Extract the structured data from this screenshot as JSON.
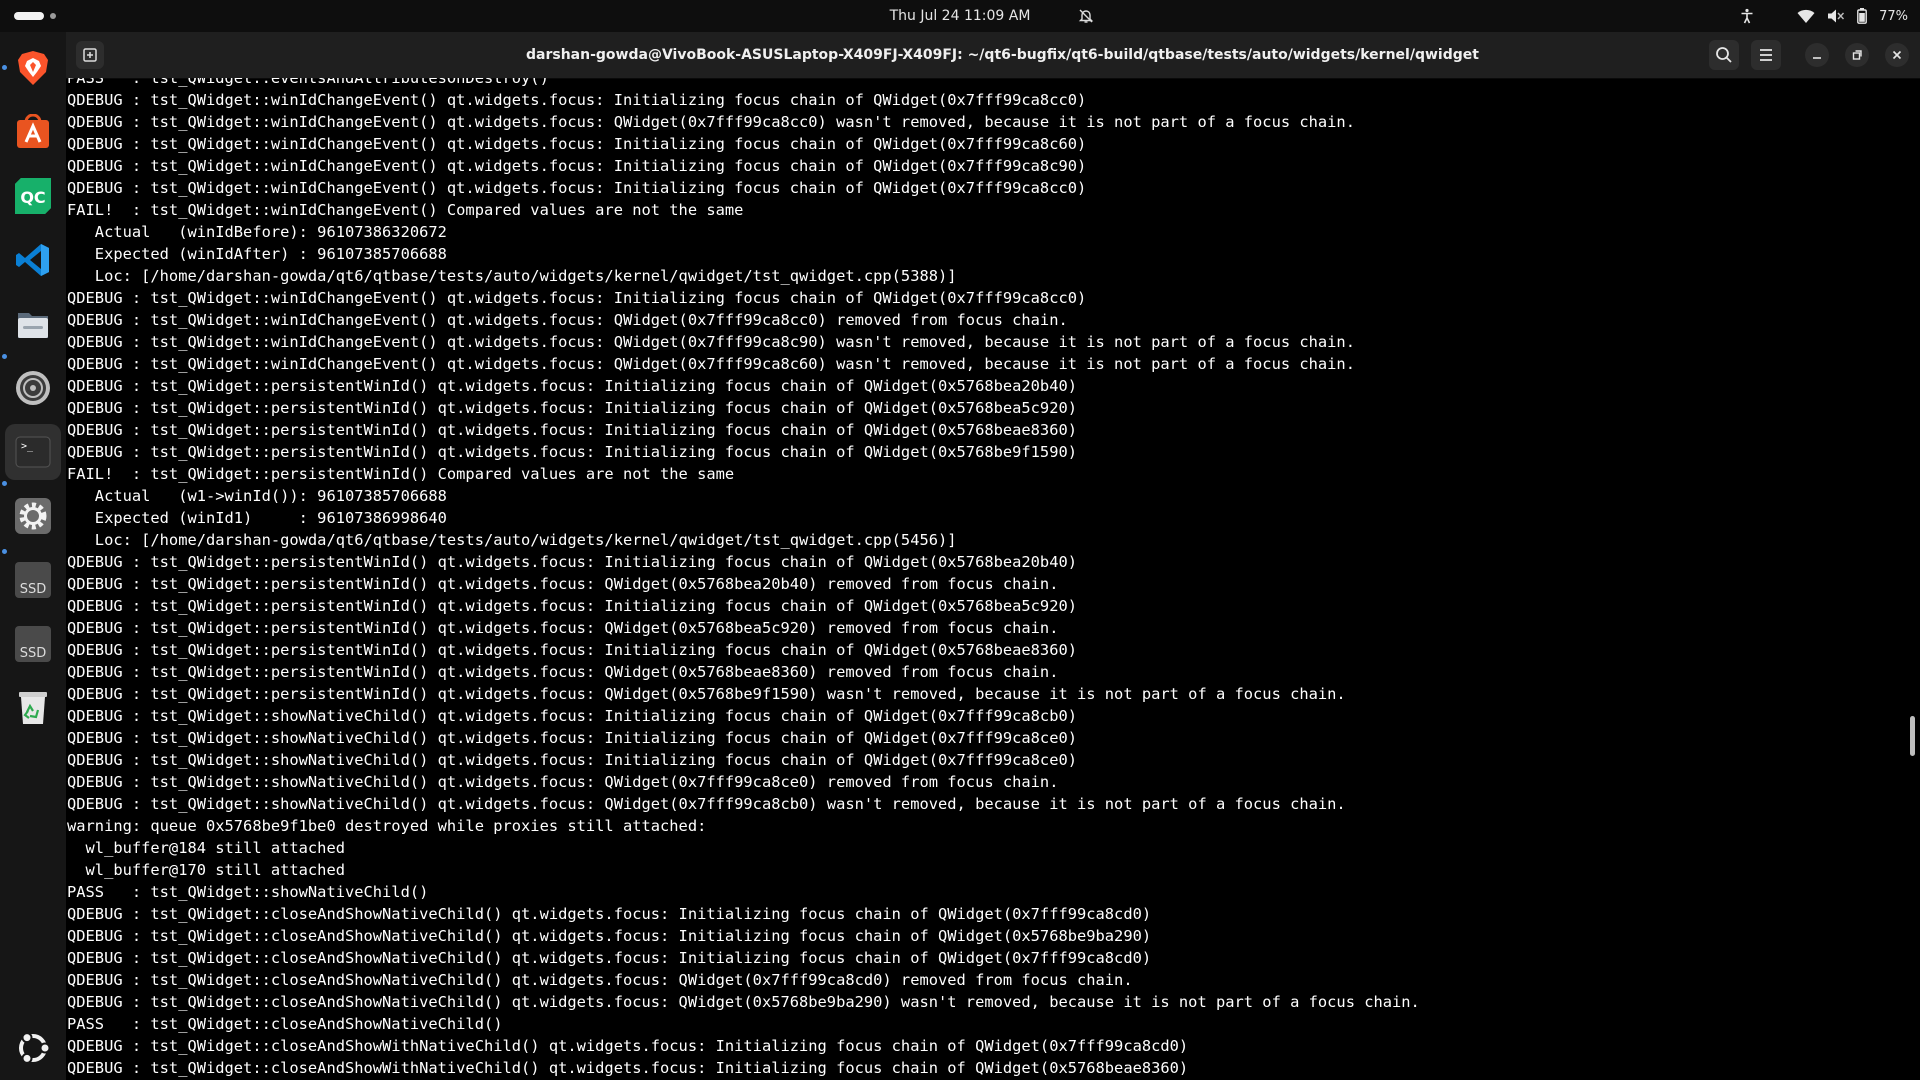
{
  "topbar": {
    "clock": "Thu Jul 24  11:09 AM",
    "battery": "77%",
    "icons": [
      "accessibility-icon",
      "wifi-icon",
      "volume-muted-icon",
      "battery-icon",
      "do-not-disturb-icon"
    ]
  },
  "dock": {
    "items": [
      "brave-browser",
      "app-center",
      "qt-creator",
      "visual-studio-code",
      "files",
      "disk-utility",
      "terminal",
      "settings",
      "ssd-drive-1",
      "ssd-drive-2",
      "trash",
      "show-apps"
    ],
    "ssd_label": "SSD"
  },
  "window": {
    "title": "darshan-gowda@VivoBook-ASUSLaptop-X409FJ-X409FJ: ~/qt6-bugfix/qt6-build/qtbase/tests/auto/widgets/kernel/qwidget"
  },
  "terminal": {
    "lines": [
      "PASS   : tst_QWidget::eventsAndAttributesOnDestroy()",
      "QDEBUG : tst_QWidget::winIdChangeEvent() qt.widgets.focus: Initializing focus chain of QWidget(0x7fff99ca8cc0)",
      "QDEBUG : tst_QWidget::winIdChangeEvent() qt.widgets.focus: QWidget(0x7fff99ca8cc0) wasn't removed, because it is not part of a focus chain.",
      "QDEBUG : tst_QWidget::winIdChangeEvent() qt.widgets.focus: Initializing focus chain of QWidget(0x7fff99ca8c60)",
      "QDEBUG : tst_QWidget::winIdChangeEvent() qt.widgets.focus: Initializing focus chain of QWidget(0x7fff99ca8c90)",
      "QDEBUG : tst_QWidget::winIdChangeEvent() qt.widgets.focus: Initializing focus chain of QWidget(0x7fff99ca8cc0)",
      "FAIL!  : tst_QWidget::winIdChangeEvent() Compared values are not the same",
      "   Actual   (winIdBefore): 96107386320672",
      "   Expected (winIdAfter) : 96107385706688",
      "   Loc: [/home/darshan-gowda/qt6/qtbase/tests/auto/widgets/kernel/qwidget/tst_qwidget.cpp(5388)]",
      "QDEBUG : tst_QWidget::winIdChangeEvent() qt.widgets.focus: Initializing focus chain of QWidget(0x7fff99ca8cc0)",
      "QDEBUG : tst_QWidget::winIdChangeEvent() qt.widgets.focus: QWidget(0x7fff99ca8cc0) removed from focus chain.",
      "QDEBUG : tst_QWidget::winIdChangeEvent() qt.widgets.focus: QWidget(0x7fff99ca8c90) wasn't removed, because it is not part of a focus chain.",
      "QDEBUG : tst_QWidget::winIdChangeEvent() qt.widgets.focus: QWidget(0x7fff99ca8c60) wasn't removed, because it is not part of a focus chain.",
      "QDEBUG : tst_QWidget::persistentWinId() qt.widgets.focus: Initializing focus chain of QWidget(0x5768bea20b40)",
      "QDEBUG : tst_QWidget::persistentWinId() qt.widgets.focus: Initializing focus chain of QWidget(0x5768bea5c920)",
      "QDEBUG : tst_QWidget::persistentWinId() qt.widgets.focus: Initializing focus chain of QWidget(0x5768beae8360)",
      "QDEBUG : tst_QWidget::persistentWinId() qt.widgets.focus: Initializing focus chain of QWidget(0x5768be9f1590)",
      "FAIL!  : tst_QWidget::persistentWinId() Compared values are not the same",
      "   Actual   (w1->winId()): 96107385706688",
      "   Expected (winId1)     : 96107386998640",
      "   Loc: [/home/darshan-gowda/qt6/qtbase/tests/auto/widgets/kernel/qwidget/tst_qwidget.cpp(5456)]",
      "QDEBUG : tst_QWidget::persistentWinId() qt.widgets.focus: Initializing focus chain of QWidget(0x5768bea20b40)",
      "QDEBUG : tst_QWidget::persistentWinId() qt.widgets.focus: QWidget(0x5768bea20b40) removed from focus chain.",
      "QDEBUG : tst_QWidget::persistentWinId() qt.widgets.focus: Initializing focus chain of QWidget(0x5768bea5c920)",
      "QDEBUG : tst_QWidget::persistentWinId() qt.widgets.focus: QWidget(0x5768bea5c920) removed from focus chain.",
      "QDEBUG : tst_QWidget::persistentWinId() qt.widgets.focus: Initializing focus chain of QWidget(0x5768beae8360)",
      "QDEBUG : tst_QWidget::persistentWinId() qt.widgets.focus: QWidget(0x5768beae8360) removed from focus chain.",
      "QDEBUG : tst_QWidget::persistentWinId() qt.widgets.focus: QWidget(0x5768be9f1590) wasn't removed, because it is not part of a focus chain.",
      "QDEBUG : tst_QWidget::showNativeChild() qt.widgets.focus: Initializing focus chain of QWidget(0x7fff99ca8cb0)",
      "QDEBUG : tst_QWidget::showNativeChild() qt.widgets.focus: Initializing focus chain of QWidget(0x7fff99ca8ce0)",
      "QDEBUG : tst_QWidget::showNativeChild() qt.widgets.focus: Initializing focus chain of QWidget(0x7fff99ca8ce0)",
      "QDEBUG : tst_QWidget::showNativeChild() qt.widgets.focus: QWidget(0x7fff99ca8ce0) removed from focus chain.",
      "QDEBUG : tst_QWidget::showNativeChild() qt.widgets.focus: QWidget(0x7fff99ca8cb0) wasn't removed, because it is not part of a focus chain.",
      "warning: queue 0x5768be9f1be0 destroyed while proxies still attached:",
      "  wl_buffer@184 still attached",
      "  wl_buffer@170 still attached",
      "PASS   : tst_QWidget::showNativeChild()",
      "QDEBUG : tst_QWidget::closeAndShowNativeChild() qt.widgets.focus: Initializing focus chain of QWidget(0x7fff99ca8cd0)",
      "QDEBUG : tst_QWidget::closeAndShowNativeChild() qt.widgets.focus: Initializing focus chain of QWidget(0x5768be9ba290)",
      "QDEBUG : tst_QWidget::closeAndShowNativeChild() qt.widgets.focus: Initializing focus chain of QWidget(0x7fff99ca8cd0)",
      "QDEBUG : tst_QWidget::closeAndShowNativeChild() qt.widgets.focus: QWidget(0x7fff99ca8cd0) removed from focus chain.",
      "QDEBUG : tst_QWidget::closeAndShowNativeChild() qt.widgets.focus: QWidget(0x5768be9ba290) wasn't removed, because it is not part of a focus chain.",
      "PASS   : tst_QWidget::closeAndShowNativeChild()",
      "QDEBUG : tst_QWidget::closeAndShowWithNativeChild() qt.widgets.focus: Initializing focus chain of QWidget(0x7fff99ca8cd0)",
      "QDEBUG : tst_QWidget::closeAndShowWithNativeChild() qt.widgets.focus: Initializing focus chain of QWidget(0x5768beae8360)"
    ]
  }
}
